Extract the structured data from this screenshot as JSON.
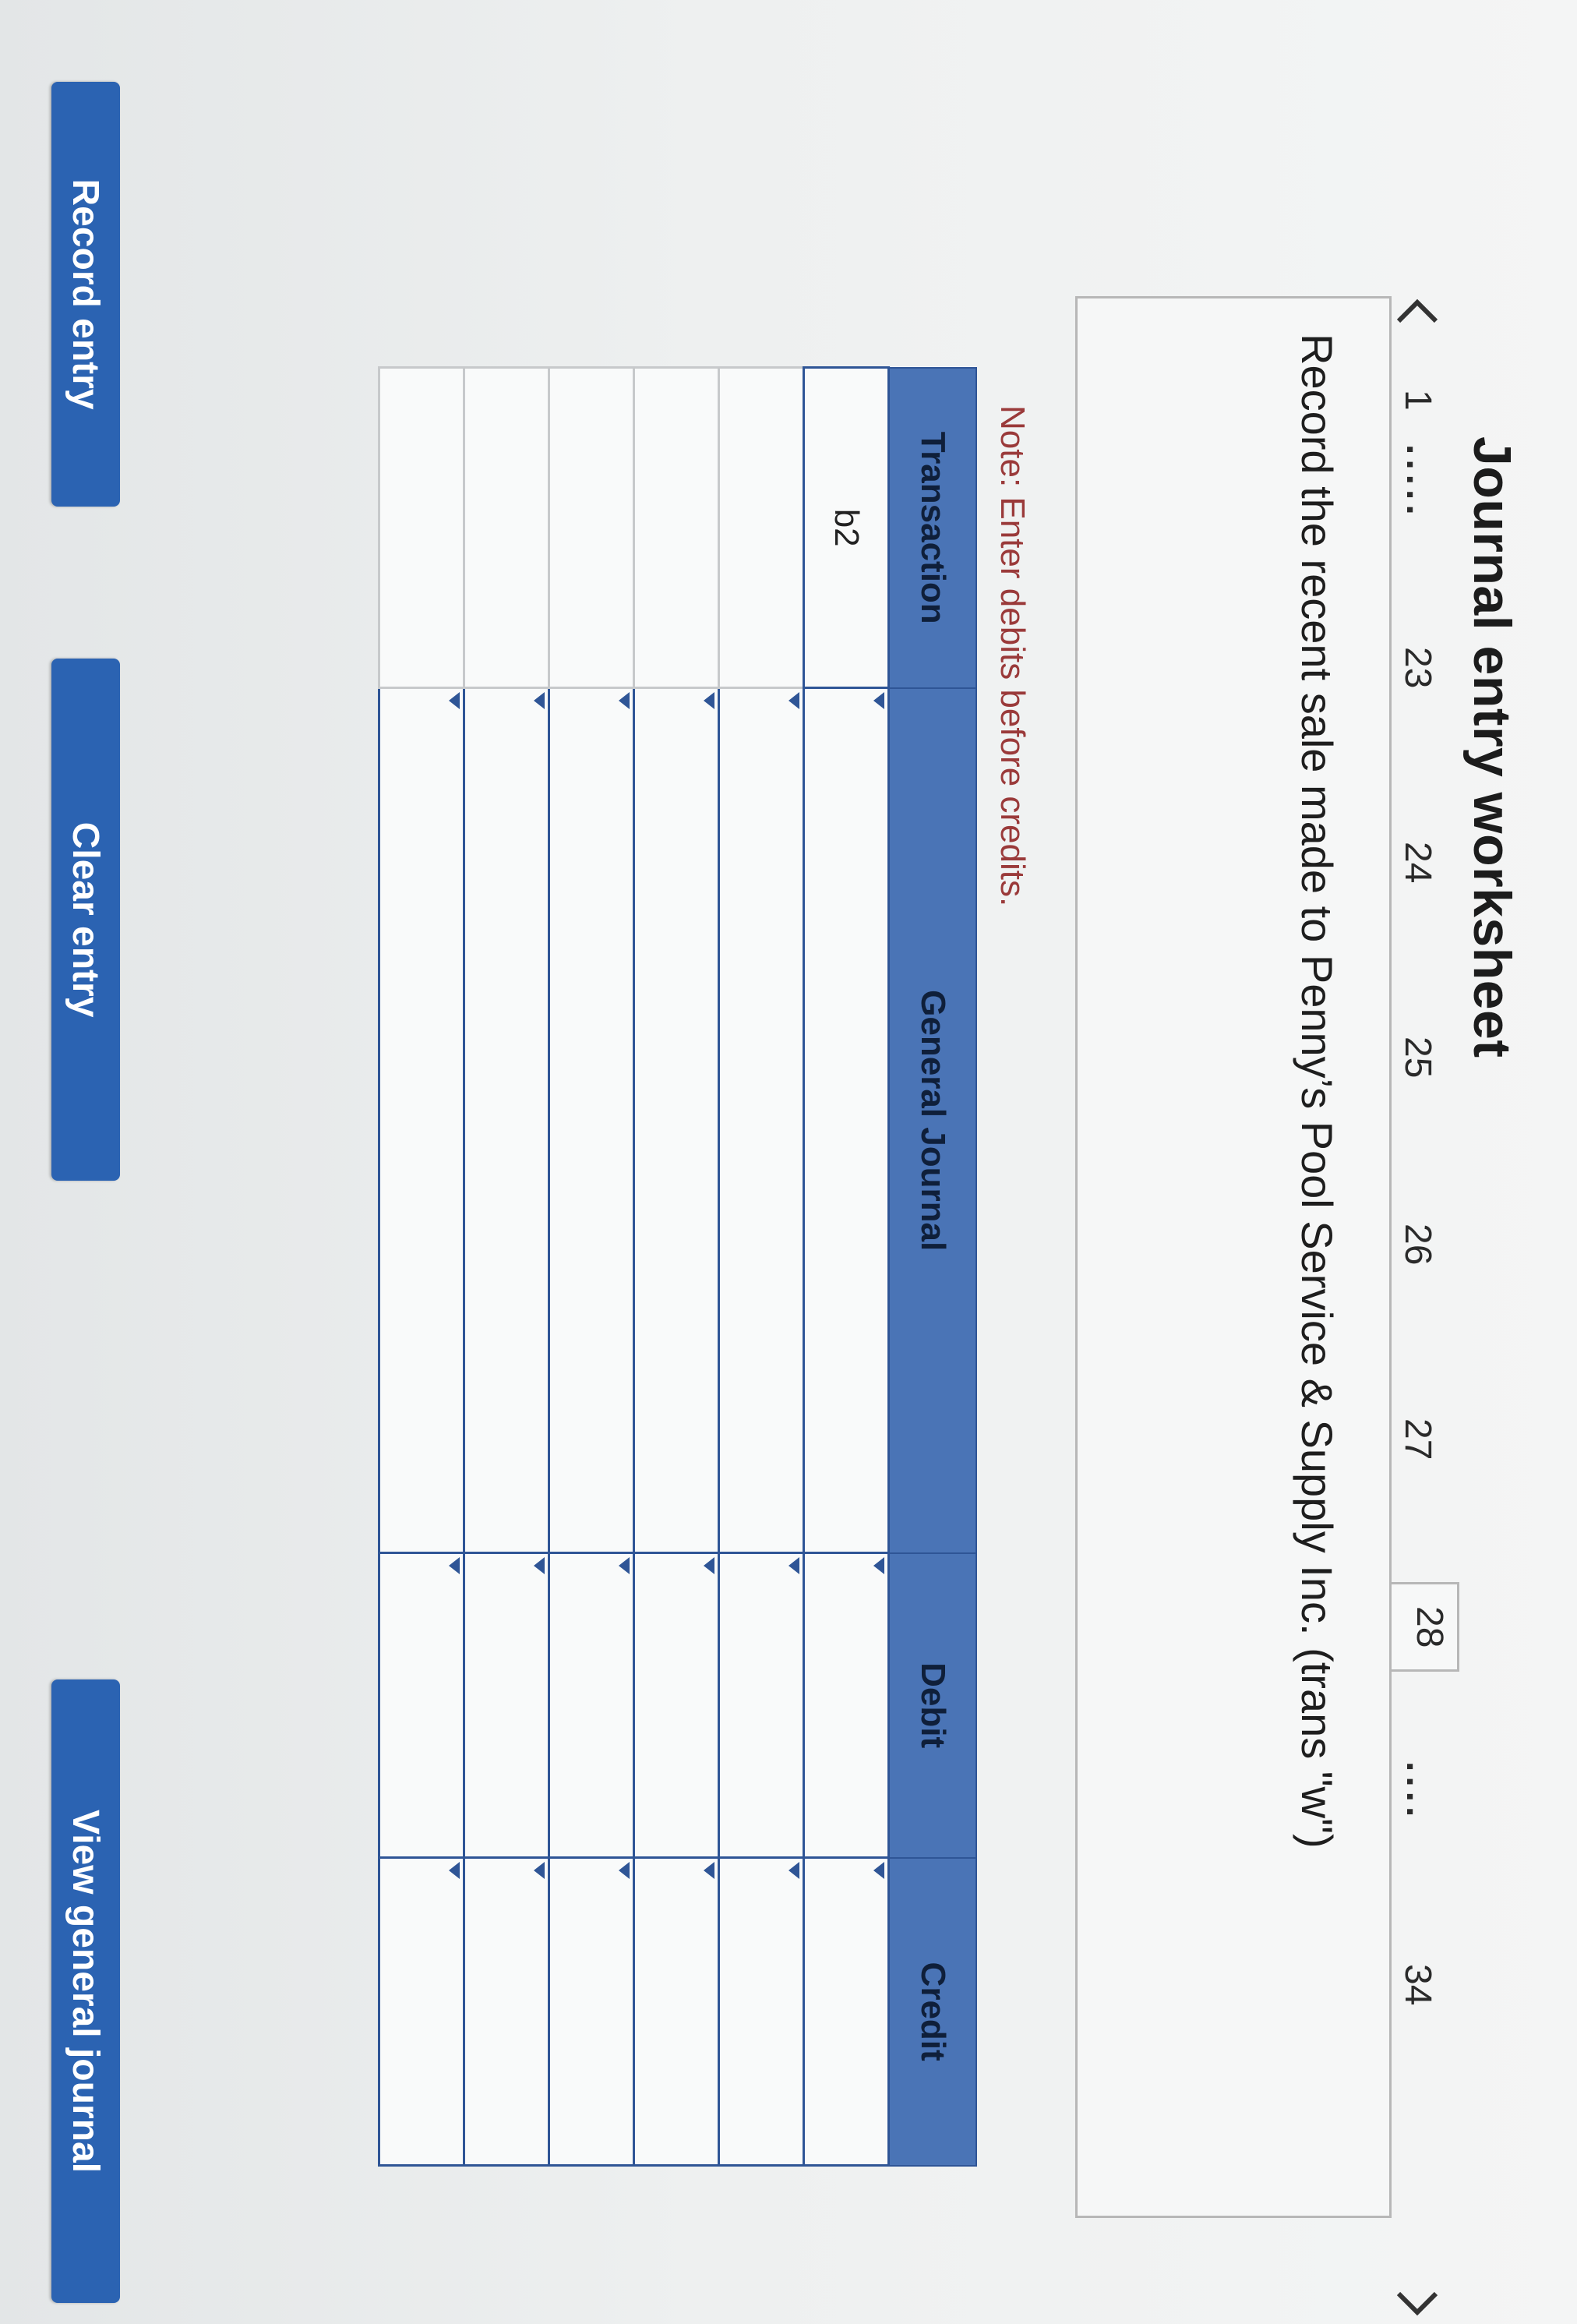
{
  "title": "Journal entry worksheet",
  "pager": {
    "prev_icon": "chevron-left-icon",
    "next_icon": "chevron-right-icon",
    "pages": [
      "1",
      "23",
      "24",
      "25",
      "26",
      "27",
      "28",
      "34"
    ],
    "ellipsis_1": ".....",
    "ellipsis_2": "....",
    "active_page": "28"
  },
  "prompt": "Record the recent sale made to Penny’s Pool Service & Supply Inc. (trans \"w\")",
  "note": "Note: Enter debits before credits.",
  "table": {
    "headers": {
      "transaction": "Transaction",
      "general_journal": "General Journal",
      "debit": "Debit",
      "credit": "Credit"
    },
    "rows": [
      {
        "transaction": "b2"
      },
      {
        "transaction": ""
      },
      {
        "transaction": ""
      },
      {
        "transaction": ""
      },
      {
        "transaction": ""
      },
      {
        "transaction": ""
      }
    ]
  },
  "buttons": {
    "record": "Record entry",
    "clear": "Clear entry",
    "view": "View general journal"
  },
  "colors": {
    "header_bg": "#4a74b6",
    "grid": "#2f5596",
    "button_bg": "#2b63b2",
    "note_text": "#9a3a3a"
  }
}
